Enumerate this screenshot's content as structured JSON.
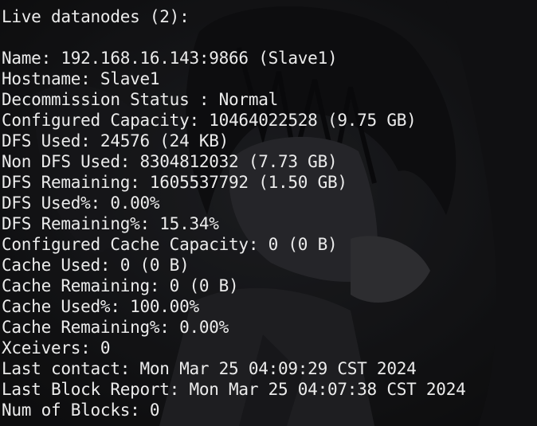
{
  "terminal": {
    "header": "Live datanodes (2):",
    "lines": [
      "Name: 192.168.16.143:9866 (Slave1)",
      "Hostname: Slave1",
      "Decommission Status : Normal",
      "Configured Capacity: 10464022528 (9.75 GB)",
      "DFS Used: 24576 (24 KB)",
      "Non DFS Used: 8304812032 (7.73 GB)",
      "DFS Remaining: 1605537792 (1.50 GB)",
      "DFS Used%: 0.00%",
      "DFS Remaining%: 15.34%",
      "Configured Cache Capacity: 0 (0 B)",
      "Cache Used: 0 (0 B)",
      "Cache Remaining: 0 (0 B)",
      "Cache Used%: 100.00%",
      "Cache Remaining%: 0.00%",
      "Xceivers: 0",
      "Last contact: Mon Mar 25 04:09:29 CST 2024",
      "Last Block Report: Mon Mar 25 04:07:38 CST 2024",
      "Num of Blocks: 0"
    ]
  },
  "colors": {
    "background": "#1b1b1e",
    "text": "#ececec"
  }
}
